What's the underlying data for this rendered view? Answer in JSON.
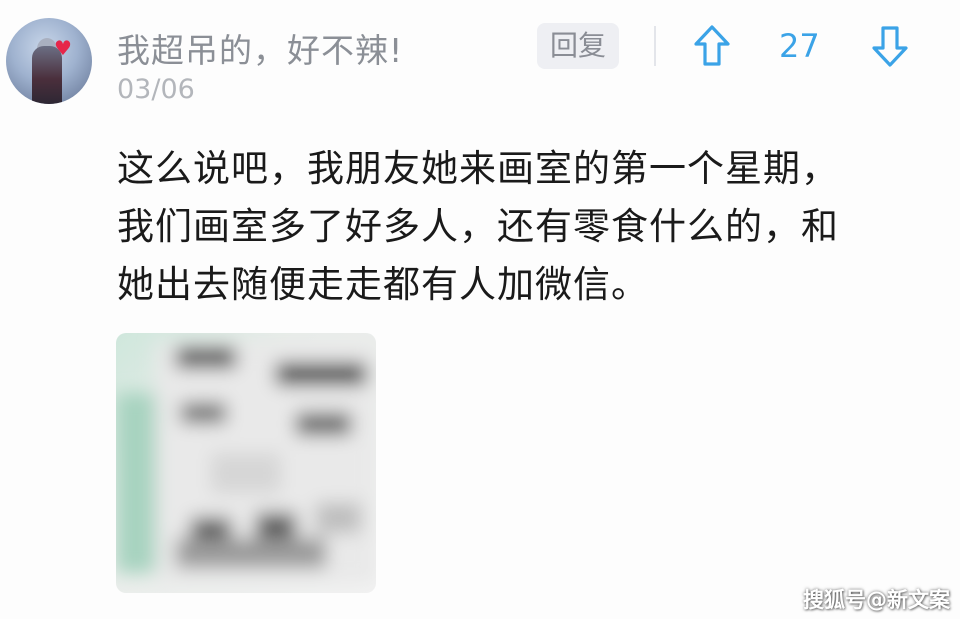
{
  "comment": {
    "username": "我超吊的，好不辣!",
    "date": "03/06",
    "reply_label": "回复",
    "vote_count": "27",
    "text_lines": [
      "这么说吧，我朋友她来画室的第一个星期，",
      "我们画室多了好多人，还有零食什么的，和",
      "她出去随便走走都有人加微信。"
    ]
  },
  "icons": {
    "avatar": "avatar-image",
    "heart": "heart-icon",
    "upvote": "arrow-up-icon",
    "downvote": "arrow-down-icon"
  },
  "colors": {
    "username": "#8b8f96",
    "date": "#b3b6bb",
    "vote_accent": "#3ba3e7",
    "reply_bg": "#eeeff3",
    "body_text": "#1a1a1a"
  },
  "watermark": "搜狐号@新文案"
}
